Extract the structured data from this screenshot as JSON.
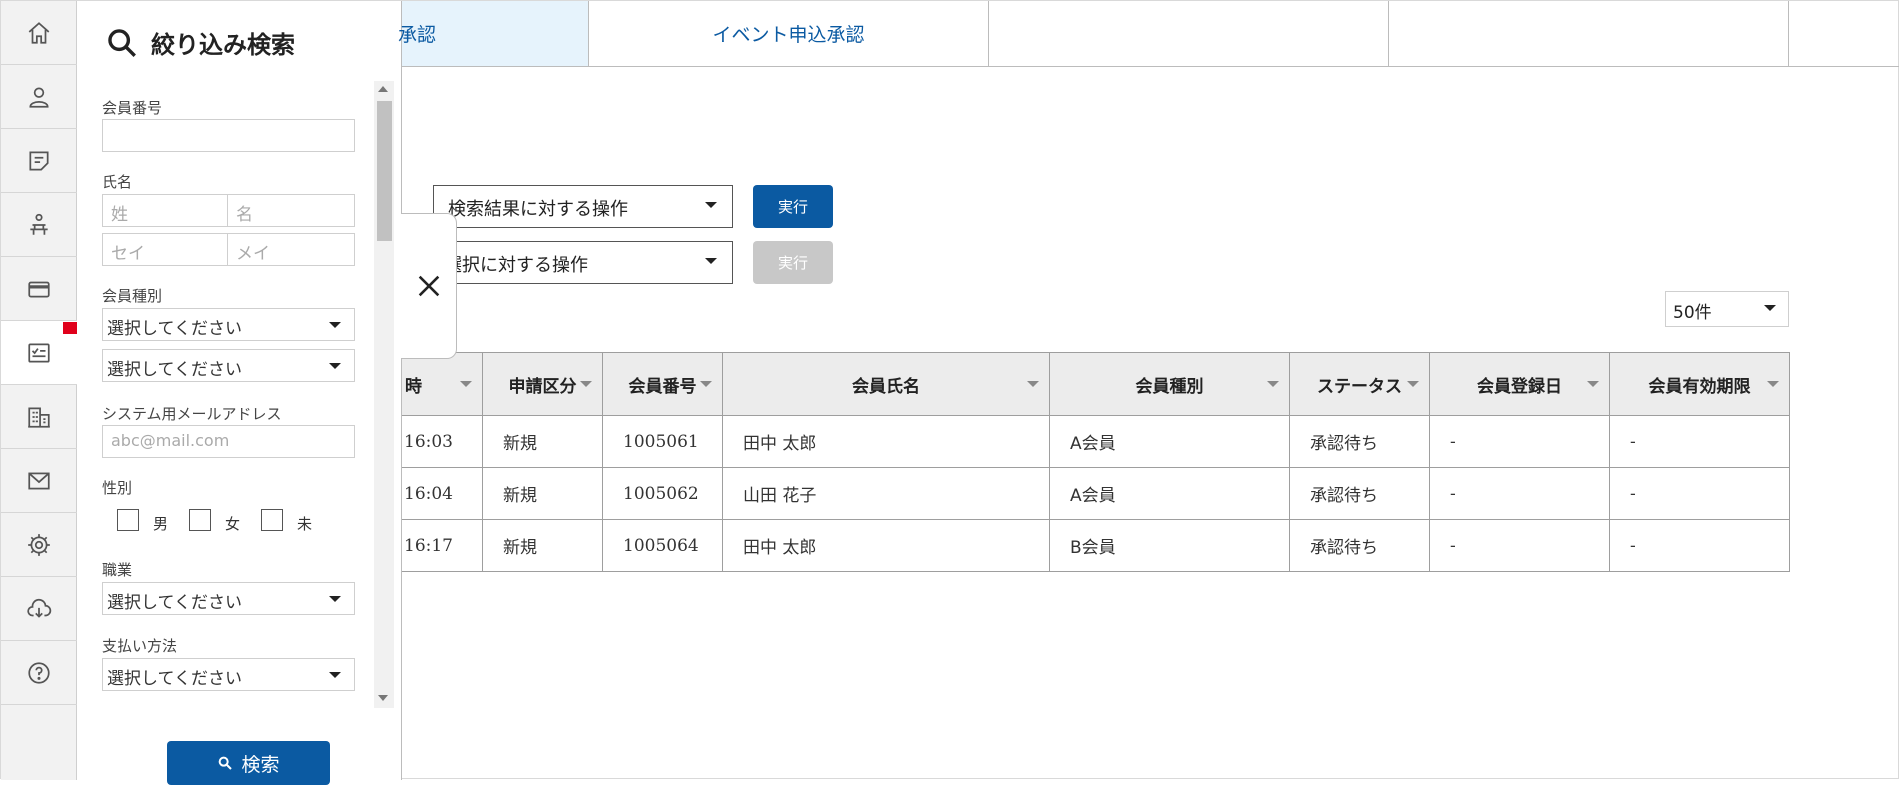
{
  "filter_panel": {
    "title": "絞り込み検索",
    "member_number": {
      "label": "会員番号",
      "value": ""
    },
    "name": {
      "label": "氏名",
      "last_placeholder": "姓",
      "first_placeholder": "名",
      "last_kana_placeholder": "セイ",
      "first_kana_placeholder": "メイ"
    },
    "member_type": {
      "label": "会員種別",
      "select1": "選択してください",
      "select2": "選択してください"
    },
    "system_email": {
      "label": "システム用メールアドレス",
      "placeholder": "abc@mail.com"
    },
    "gender": {
      "label": "性別",
      "options": [
        "男",
        "女",
        "未"
      ]
    },
    "occupation": {
      "label": "職業",
      "select": "選択してください"
    },
    "payment": {
      "label": "支払い方法",
      "select": "選択してください"
    },
    "search_button": "検索"
  },
  "tabs": [
    {
      "label": "承認",
      "active": true
    },
    {
      "label": "イベント申込承認",
      "active": false
    },
    {
      "label": "",
      "active": false
    },
    {
      "label": "",
      "active": false
    },
    {
      "label": "",
      "active": false
    }
  ],
  "actions": {
    "search_result_op": "検索結果に対する操作",
    "selection_op": "選択に対する操作",
    "execute_label": "実行",
    "execute_disabled_label": "実行"
  },
  "per_page": "50件",
  "table": {
    "columns": [
      "時",
      "申請区分",
      "会員番号",
      "会員氏名",
      "会員種別",
      "ステータス",
      "会員登録日",
      "会員有効期限"
    ],
    "rows": [
      [
        "16:03",
        "新規",
        "1005061",
        "田中 太郎",
        "A会員",
        "承認待ち",
        "-",
        "-"
      ],
      [
        "16:04",
        "新規",
        "1005062",
        "山田 花子",
        "A会員",
        "承認待ち",
        "-",
        "-"
      ],
      [
        "16:17",
        "新規",
        "1005064",
        "田中 太郎",
        "B会員",
        "承認待ち",
        "-",
        "-"
      ]
    ]
  },
  "colors": {
    "primary": "#0b5aa2",
    "active_tab_bg": "#e6f3fc",
    "notification": "#e0001b"
  }
}
